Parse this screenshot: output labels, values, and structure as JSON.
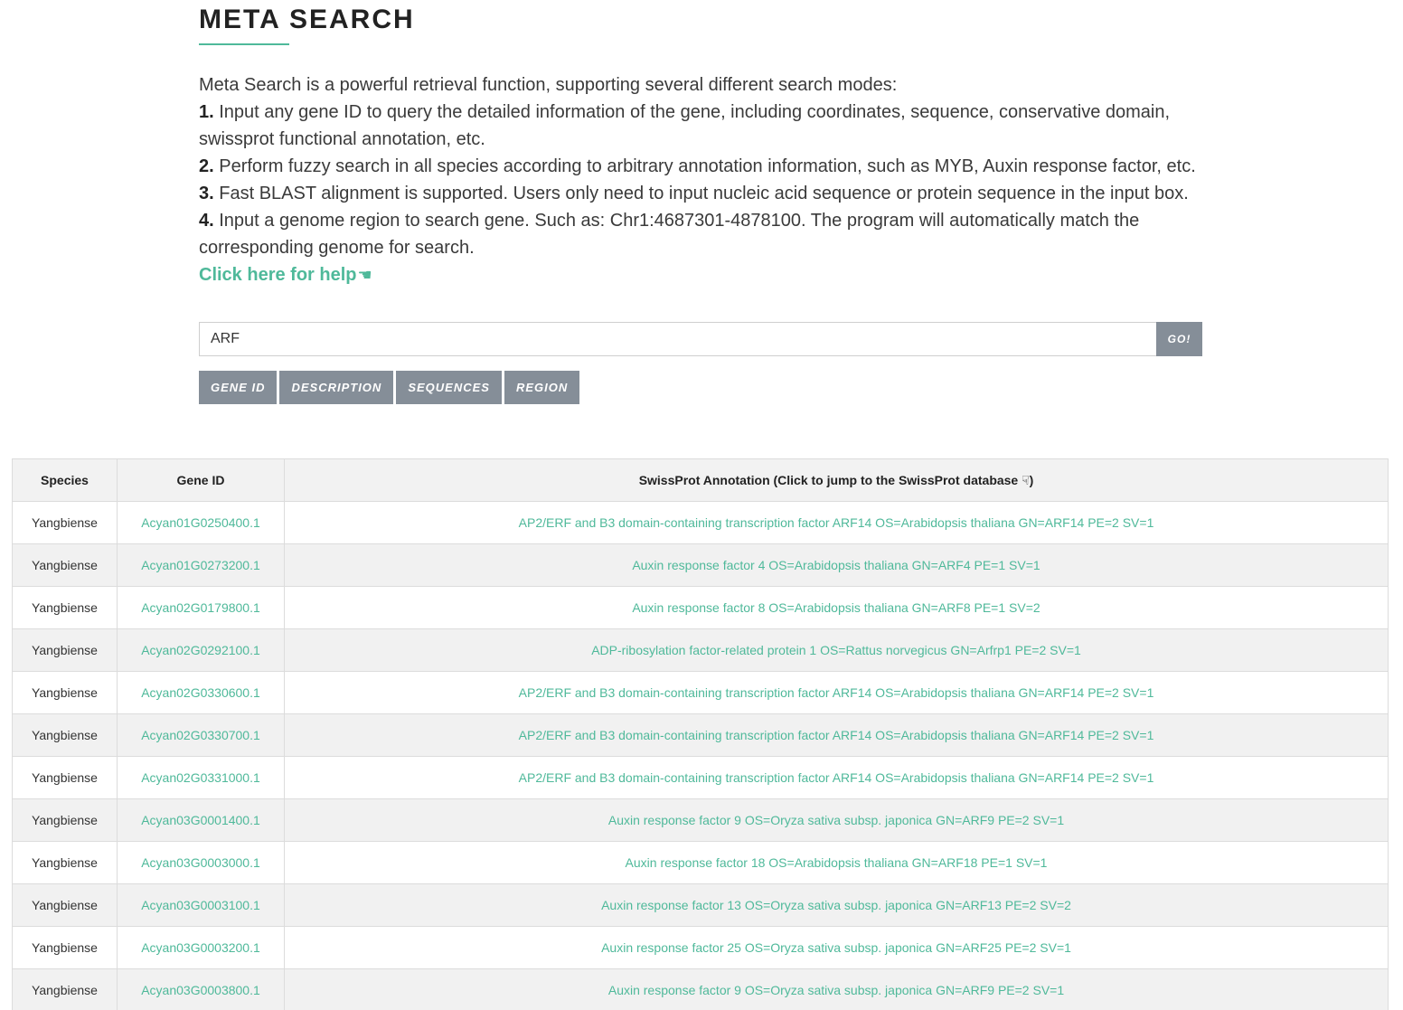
{
  "header": {
    "title": "META SEARCH"
  },
  "intro": {
    "lead": "Meta Search is a powerful retrieval function, supporting several different search modes:",
    "items": [
      {
        "num": "1.",
        "text": " Input any gene ID to query the detailed information of the gene, including coordinates, sequence, conservative domain, swissprot functional annotation, etc."
      },
      {
        "num": "2.",
        "text": " Perform fuzzy search in all species according to arbitrary annotation information, such as MYB, Auxin response factor, etc."
      },
      {
        "num": "3.",
        "text": " Fast BLAST alignment is supported. Users only need to input nucleic acid sequence or protein sequence in the input box."
      },
      {
        "num": "4.",
        "text": " Input a genome region to search gene. Such as: Chr1:4687301-4878100. The program will automatically match the corresponding genome for search."
      }
    ],
    "help_link": "Click here for help",
    "help_icon": "☚"
  },
  "search": {
    "value": "ARF",
    "go_label": "GO!"
  },
  "modes": [
    "GENE ID",
    "DESCRIPTION",
    "SEQUENCES",
    "REGION"
  ],
  "table": {
    "headers": [
      "Species",
      "Gene ID",
      "SwissProt Annotation (Click to jump to the SwissProt database ☟)"
    ],
    "rows": [
      {
        "species": "Yangbiense",
        "gene_id": "Acyan01G0250400.1",
        "annotation": "AP2/ERF and B3 domain-containing transcription factor ARF14 OS=Arabidopsis thaliana GN=ARF14 PE=2 SV=1"
      },
      {
        "species": "Yangbiense",
        "gene_id": "Acyan01G0273200.1",
        "annotation": "Auxin response factor 4 OS=Arabidopsis thaliana GN=ARF4 PE=1 SV=1"
      },
      {
        "species": "Yangbiense",
        "gene_id": "Acyan02G0179800.1",
        "annotation": "Auxin response factor 8 OS=Arabidopsis thaliana GN=ARF8 PE=1 SV=2"
      },
      {
        "species": "Yangbiense",
        "gene_id": "Acyan02G0292100.1",
        "annotation": "ADP-ribosylation factor-related protein 1 OS=Rattus norvegicus GN=Arfrp1 PE=2 SV=1"
      },
      {
        "species": "Yangbiense",
        "gene_id": "Acyan02G0330600.1",
        "annotation": "AP2/ERF and B3 domain-containing transcription factor ARF14 OS=Arabidopsis thaliana GN=ARF14 PE=2 SV=1"
      },
      {
        "species": "Yangbiense",
        "gene_id": "Acyan02G0330700.1",
        "annotation": "AP2/ERF and B3 domain-containing transcription factor ARF14 OS=Arabidopsis thaliana GN=ARF14 PE=2 SV=1"
      },
      {
        "species": "Yangbiense",
        "gene_id": "Acyan02G0331000.1",
        "annotation": "AP2/ERF and B3 domain-containing transcription factor ARF14 OS=Arabidopsis thaliana GN=ARF14 PE=2 SV=1"
      },
      {
        "species": "Yangbiense",
        "gene_id": "Acyan03G0001400.1",
        "annotation": "Auxin response factor 9 OS=Oryza sativa subsp. japonica GN=ARF9 PE=2 SV=1"
      },
      {
        "species": "Yangbiense",
        "gene_id": "Acyan03G0003000.1",
        "annotation": "Auxin response factor 18 OS=Arabidopsis thaliana GN=ARF18 PE=1 SV=1"
      },
      {
        "species": "Yangbiense",
        "gene_id": "Acyan03G0003100.1",
        "annotation": "Auxin response factor 13 OS=Oryza sativa subsp. japonica GN=ARF13 PE=2 SV=2"
      },
      {
        "species": "Yangbiense",
        "gene_id": "Acyan03G0003200.1",
        "annotation": "Auxin response factor 25 OS=Oryza sativa subsp. japonica GN=ARF25 PE=2 SV=1"
      },
      {
        "species": "Yangbiense",
        "gene_id": "Acyan03G0003800.1",
        "annotation": "Auxin response factor 9 OS=Oryza sativa subsp. japonica GN=ARF9 PE=2 SV=1"
      }
    ]
  },
  "colors": {
    "accent": "#4fb99a",
    "button": "#858e98"
  }
}
